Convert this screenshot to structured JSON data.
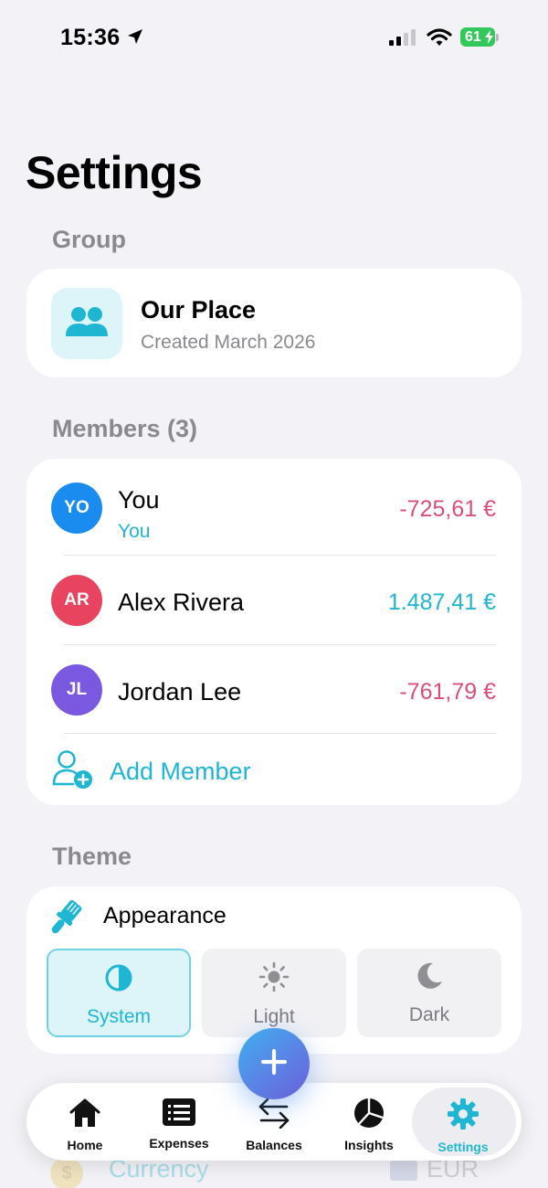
{
  "status_bar": {
    "time": "15:36",
    "battery_level": "61"
  },
  "page": {
    "title": "Settings"
  },
  "group_section": {
    "label": "Group",
    "name": "Our Place",
    "created": "Created March 2026",
    "icon": "people-icon"
  },
  "members_section": {
    "label": "Members (3)",
    "members": [
      {
        "initials": "YO",
        "name": "You",
        "tag": "You",
        "amount": "-725,61 €",
        "avatar_color": "#1a8cf0",
        "amount_color": "#d94f78"
      },
      {
        "initials": "AR",
        "name": "Alex Rivera",
        "amount": "1.487,41 €",
        "avatar_color": "#e8435f",
        "amount_color": "#1fb6d4"
      },
      {
        "initials": "JL",
        "name": "Jordan Lee",
        "amount": "-761,79 €",
        "avatar_color": "#7b58e0",
        "amount_color": "#d94f78"
      }
    ],
    "add_member_label": "Add Member"
  },
  "theme_section": {
    "label": "Theme",
    "appearance_title": "Appearance",
    "options": [
      {
        "label": "System",
        "icon": "half-circle-icon",
        "selected": true
      },
      {
        "label": "Light",
        "icon": "sun-icon",
        "selected": false
      },
      {
        "label": "Dark",
        "icon": "moon-icon",
        "selected": false
      }
    ]
  },
  "hidden_row": {
    "label": "Currency",
    "value": "EUR"
  },
  "tab_bar": {
    "tabs": [
      {
        "label": "Home",
        "icon": "house-icon"
      },
      {
        "label": "Expenses",
        "icon": "list-icon"
      },
      {
        "label": "Balances",
        "icon": "arrows-icon"
      },
      {
        "label": "Insights",
        "icon": "pie-chart-icon"
      },
      {
        "label": "Settings",
        "icon": "gear-icon",
        "active": true
      }
    ]
  },
  "colors": {
    "accent": "#1fb6d4",
    "negative": "#d94f78",
    "background": "#f2f2f7"
  }
}
